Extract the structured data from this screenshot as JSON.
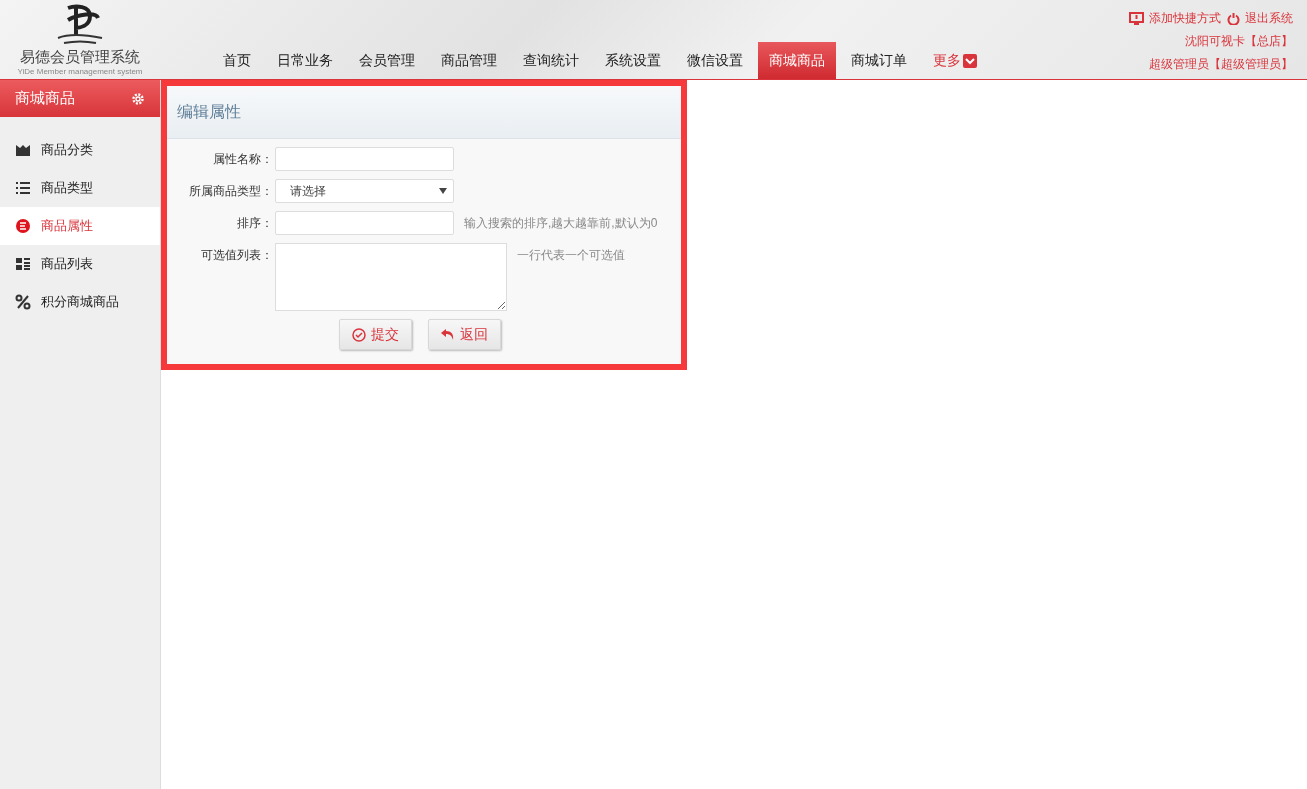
{
  "logo": {
    "title": "易德会员管理系统",
    "subtitle": "YiDe Member management system"
  },
  "nav": [
    {
      "label": "首页",
      "selected": false,
      "kind": "item"
    },
    {
      "label": "日常业务",
      "selected": false,
      "kind": "item"
    },
    {
      "label": "会员管理",
      "selected": false,
      "kind": "item"
    },
    {
      "label": "商品管理",
      "selected": false,
      "kind": "item"
    },
    {
      "label": "查询统计",
      "selected": false,
      "kind": "item"
    },
    {
      "label": "系统设置",
      "selected": false,
      "kind": "item"
    },
    {
      "label": "微信设置",
      "selected": false,
      "kind": "item"
    },
    {
      "label": "商城商品",
      "selected": true,
      "kind": "item"
    },
    {
      "label": "商城订单",
      "selected": false,
      "kind": "item"
    },
    {
      "label": "更多",
      "selected": false,
      "kind": "more"
    }
  ],
  "header_links": {
    "shortcut": "添加快捷方式",
    "logout": "退出系统",
    "store": "沈阳可视卡【总店】",
    "user": "超级管理员【超级管理员】"
  },
  "sidebar": {
    "title": "商城商品",
    "items": [
      {
        "label": "商品分类",
        "selected": false
      },
      {
        "label": "商品类型",
        "selected": false
      },
      {
        "label": "商品属性",
        "selected": true
      },
      {
        "label": "商品列表",
        "selected": false
      },
      {
        "label": "积分商城商品",
        "selected": false
      }
    ]
  },
  "form": {
    "title": "编辑属性",
    "fields": [
      {
        "label": "属性名称：",
        "kind": "text"
      },
      {
        "label": "所属商品类型：",
        "kind": "select",
        "value": "请选择"
      },
      {
        "label": "排序：",
        "kind": "text",
        "hint": "输入搜索的排序,越大越靠前,默认为0"
      },
      {
        "label": "可选值列表：",
        "kind": "textarea",
        "hint": "一行代表一个可选值"
      }
    ],
    "buttons": [
      {
        "label": "提交",
        "kind": "submit"
      },
      {
        "label": "返回",
        "kind": "back"
      }
    ]
  }
}
